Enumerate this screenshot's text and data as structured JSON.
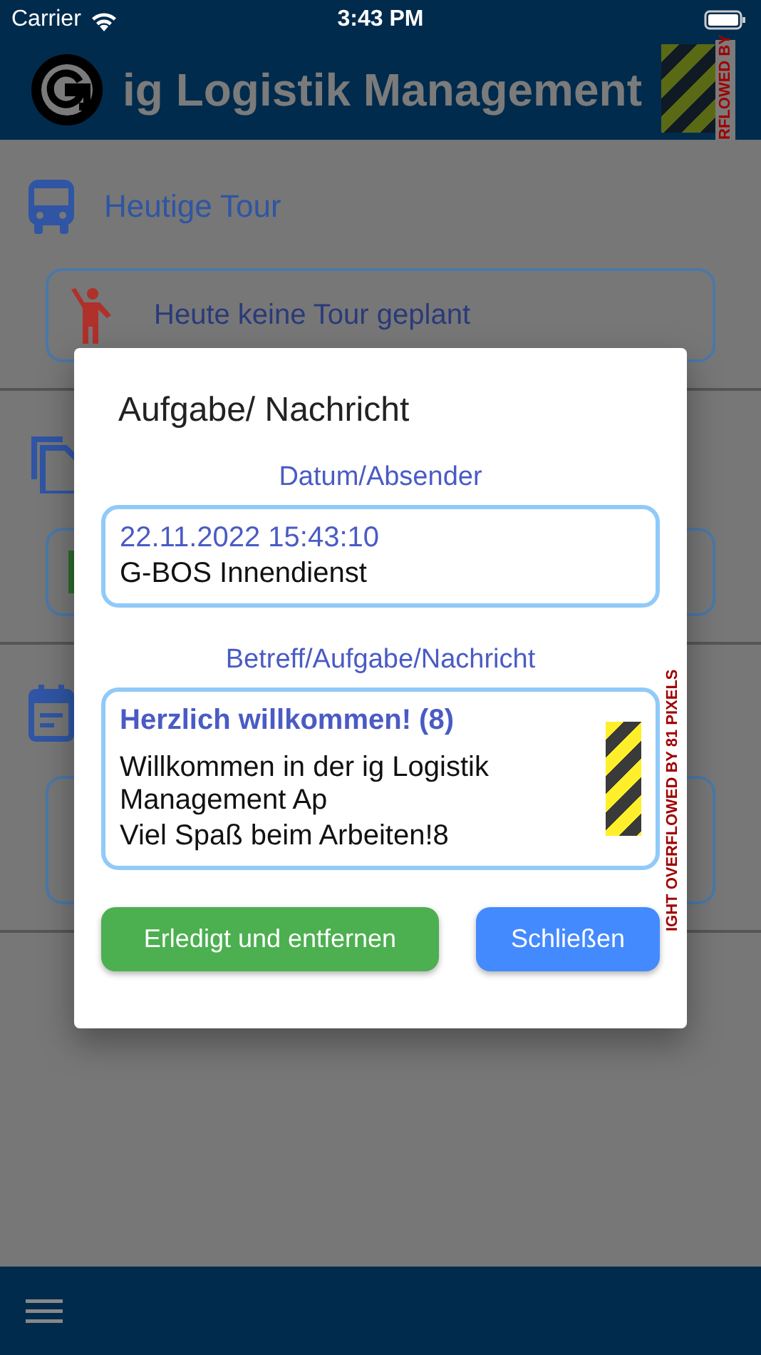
{
  "status_bar": {
    "carrier": "Carrier",
    "time": "3:43 PM"
  },
  "header": {
    "title": "ig Logistik Management",
    "overflow_label": "RFLOWED BY"
  },
  "sections": [
    {
      "kind": "tour",
      "title": "Heutige Tour",
      "card_text": "Heute keine Tour geplant"
    },
    {
      "kind": "documents"
    },
    {
      "kind": "calendar"
    }
  ],
  "dialog": {
    "title": "Aufgabe/ Nachricht",
    "date_label": "Datum/Absender",
    "date": "22.11.2022 15:43:10",
    "sender": "G-BOS Innendienst",
    "message_label": "Betreff/Aufgabe/Nachricht",
    "subject": "Herzlich willkommen! (8)",
    "body_lines": [
      "Willkommen in der ig Logistik Management Ap",
      "Viel Spaß beim Arbeiten!8"
    ],
    "overflow_label": "IGHT OVERFLOWED BY 81 PIXELS",
    "buttons": [
      {
        "kind": "done",
        "label": "Erledigt und entfernen"
      },
      {
        "kind": "close",
        "label": "Schließen"
      }
    ]
  }
}
